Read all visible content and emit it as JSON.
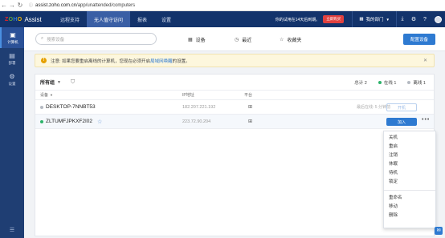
{
  "browser": {
    "url_host": "assist.zoho.com.cn",
    "url_path": "/app/unattended/computers"
  },
  "header": {
    "logo_text": "ZOHO",
    "app_name": "Assist",
    "tabs": [
      {
        "label": "远程支持"
      },
      {
        "label": "无人值守访问"
      },
      {
        "label": "报表"
      },
      {
        "label": "设置"
      }
    ],
    "trial_text": "你的试用在14天后到期。",
    "trial_button": "立即购买",
    "department": "我的部门"
  },
  "sidebar": {
    "items": [
      {
        "label": "计算机"
      },
      {
        "label": "部署"
      },
      {
        "label": "设置"
      }
    ]
  },
  "toolbar": {
    "search_placeholder": "搜索设备",
    "devices_label": "设备",
    "recent_label": "最近",
    "favorites_label": "收藏夹",
    "configure_button": "配置设备"
  },
  "notice": {
    "text_prefix": "注意: 如果您要重启离线的计算机，您现在必须开启",
    "link_text": "局域网唤醒",
    "text_suffix": "的设置。"
  },
  "panel": {
    "group_label": "所有组",
    "total_label": "总计 2",
    "online_label": "在线 1",
    "offline_label": "离线 1",
    "columns": {
      "device": "设备",
      "ip": "IP地址",
      "platform": "平台"
    },
    "rows": [
      {
        "name": "DESKTOP-7NNBT53",
        "ip": "182.207.221.192",
        "last_online": "最后在线: 5 分钟前",
        "action": "开机"
      },
      {
        "name": "ZLTUMFJPKXF2I02",
        "ip": "223.72.90.204",
        "last_online": "",
        "action": "加入"
      }
    ]
  },
  "dropdown": {
    "group1": [
      "关机",
      "重启",
      "注销",
      "休眠",
      "待机",
      "锁定"
    ],
    "group2": [
      "重命名",
      "移动",
      "删除"
    ]
  },
  "colors": {
    "header_bg": "#13336b",
    "sidebar_bg": "#1f3e73",
    "primary": "#2e7ad1",
    "online": "#2db36a",
    "trial_red": "#e1413f"
  }
}
